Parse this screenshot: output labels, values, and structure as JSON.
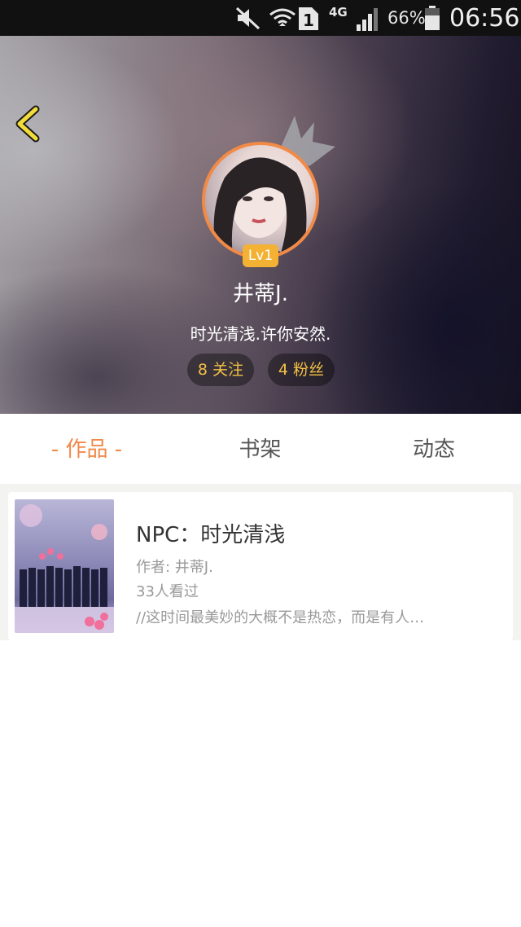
{
  "status_bar": {
    "battery_percent": "66%",
    "time": "06:56",
    "network_type": "4G",
    "sim_slot": "1",
    "icons": [
      "mute-icon",
      "wifi-icon",
      "sim-icon",
      "signal-icon",
      "battery-icon"
    ]
  },
  "profile": {
    "level": "Lv1",
    "username": "井蒂J.",
    "signature": "时光清浅.许你安然.",
    "follow_label": "8 关注",
    "fans_label": "4 粉丝"
  },
  "tabs": [
    {
      "label": "- 作品 -",
      "active": true
    },
    {
      "label": "书架",
      "active": false
    },
    {
      "label": "动态",
      "active": false
    }
  ],
  "books": [
    {
      "title": "NPC：时光清浅",
      "author": "作者: 井蒂J.",
      "views": "33人看过",
      "excerpt": "//这时间最美妙的大概不是热恋，而是有人…"
    }
  ],
  "colors": {
    "accent": "#f2884a",
    "pill_text": "#f3c143",
    "level_badge": "#f3b234"
  }
}
